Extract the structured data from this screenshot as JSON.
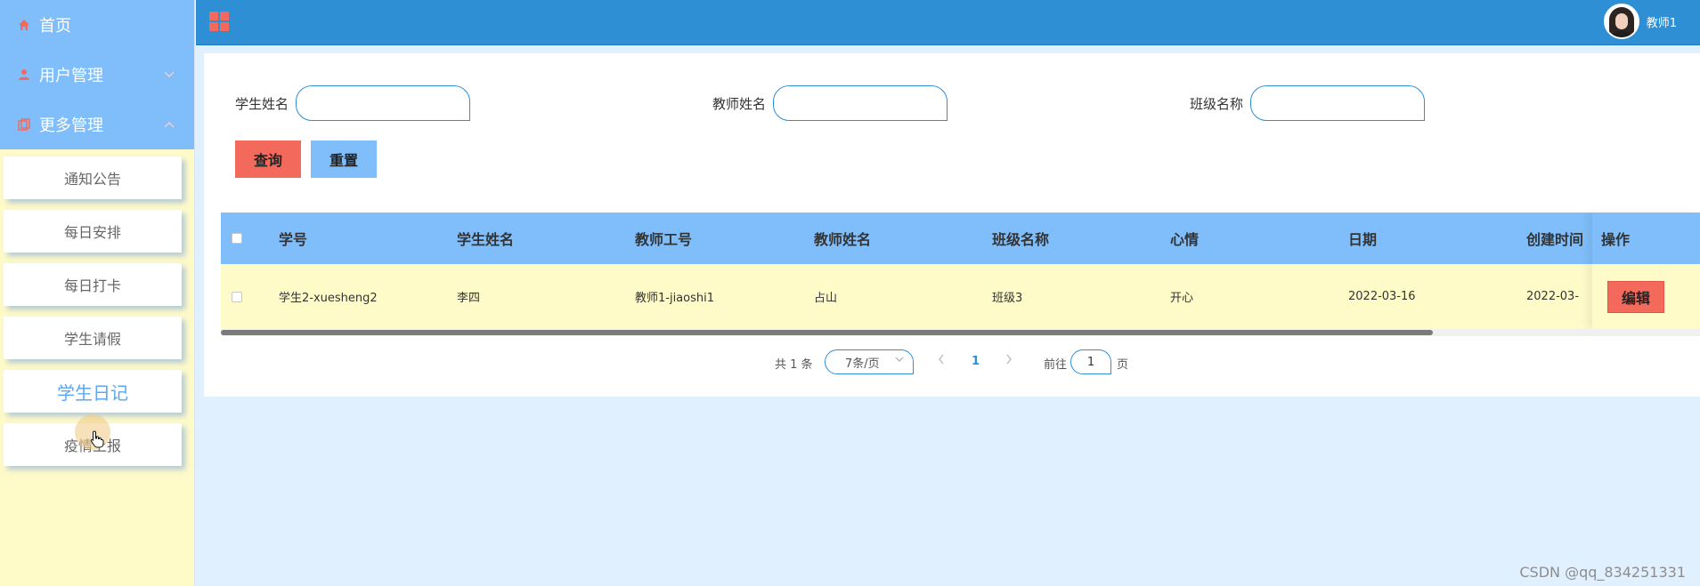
{
  "sidebar": {
    "top_items": [
      {
        "label": "首页",
        "icon": "home-icon"
      },
      {
        "label": "用户管理",
        "icon": "user-icon",
        "arrow": "chevron-down-icon"
      },
      {
        "label": "更多管理",
        "icon": "copy-icon",
        "arrow": "chevron-up-icon"
      }
    ],
    "sub_items": [
      {
        "label": "通知公告"
      },
      {
        "label": "每日安排"
      },
      {
        "label": "每日打卡"
      },
      {
        "label": "学生请假"
      },
      {
        "label": "学生日记",
        "active": true
      },
      {
        "label": "疫情上报"
      }
    ]
  },
  "header": {
    "user_name": "教师1"
  },
  "search": {
    "student_name_label": "学生姓名",
    "teacher_name_label": "教师姓名",
    "class_name_label": "班级名称",
    "query_label": "查询",
    "reset_label": "重置"
  },
  "table": {
    "columns": [
      "学号",
      "学生姓名",
      "教师工号",
      "教师姓名",
      "班级名称",
      "心情",
      "日期",
      "创建时间",
      "操作"
    ],
    "rows": [
      {
        "student_no": "学生2-xuesheng2",
        "student_name": "李四",
        "teacher_no": "教师1-jiaoshi1",
        "teacher_name": "占山",
        "class_name": "班级3",
        "mood": "开心",
        "date": "2022-03-16",
        "created": "2022-03-",
        "edit_label": "编辑"
      }
    ]
  },
  "pagination": {
    "total": "共 1 条",
    "page_size": "7条/页",
    "current_page": "1",
    "goto_label": "前往",
    "goto_value": "1",
    "page_unit": "页"
  },
  "watermark": "CSDN @qq_834251331",
  "colors": {
    "accent_blue": "#2f8fd5",
    "light_blue": "#7fbefa",
    "red": "#f36a5d",
    "cream": "#fffbc9",
    "page_bg": "#e1f0ff"
  }
}
